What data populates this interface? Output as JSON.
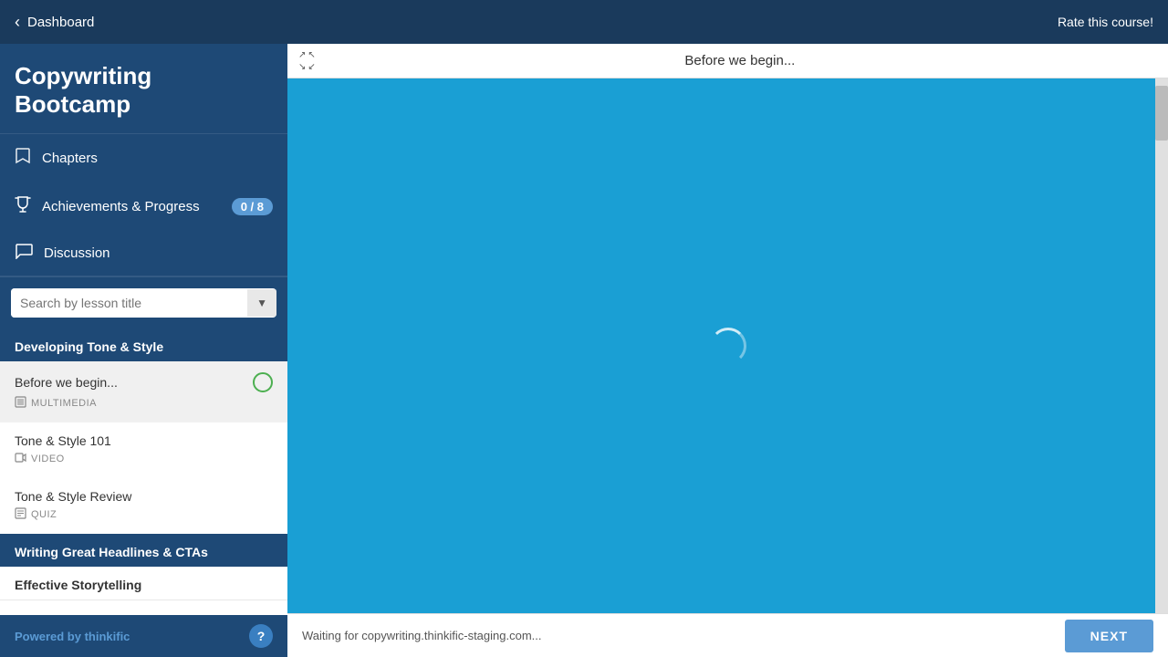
{
  "topBar": {
    "back_label": "Dashboard",
    "rate_label": "Rate this course!"
  },
  "sidebar": {
    "course_title": "Copywriting Bootcamp",
    "nav": {
      "chapters_label": "Chapters",
      "achievements_label": "Achievements & Progress",
      "achievements_badge": "0 / 8",
      "discussion_label": "Discussion"
    },
    "search": {
      "placeholder": "Search by lesson title"
    },
    "chapters": [
      {
        "id": "developing",
        "title": "Developing Tone & Style",
        "lessons": [
          {
            "id": "before-we-begin",
            "title": "Before we begin...",
            "type": "MULTIMEDIA",
            "active": true
          },
          {
            "id": "tone-style-101",
            "title": "Tone & Style 101",
            "type": "VIDEO",
            "active": false
          },
          {
            "id": "tone-style-review",
            "title": "Tone & Style Review",
            "type": "QUIZ",
            "active": false
          }
        ]
      },
      {
        "id": "headlines",
        "title": "Writing Great Headlines & CTAs",
        "lessons": []
      },
      {
        "id": "storytelling",
        "title": "Effective Storytelling",
        "lessons": []
      }
    ],
    "powered_by": "Powered by thinkific",
    "help_label": "?"
  },
  "content": {
    "video_title": "Before we begin...",
    "status_text": "Waiting for copywriting.thinkific-staging.com...",
    "next_button_label": "NEXT"
  }
}
